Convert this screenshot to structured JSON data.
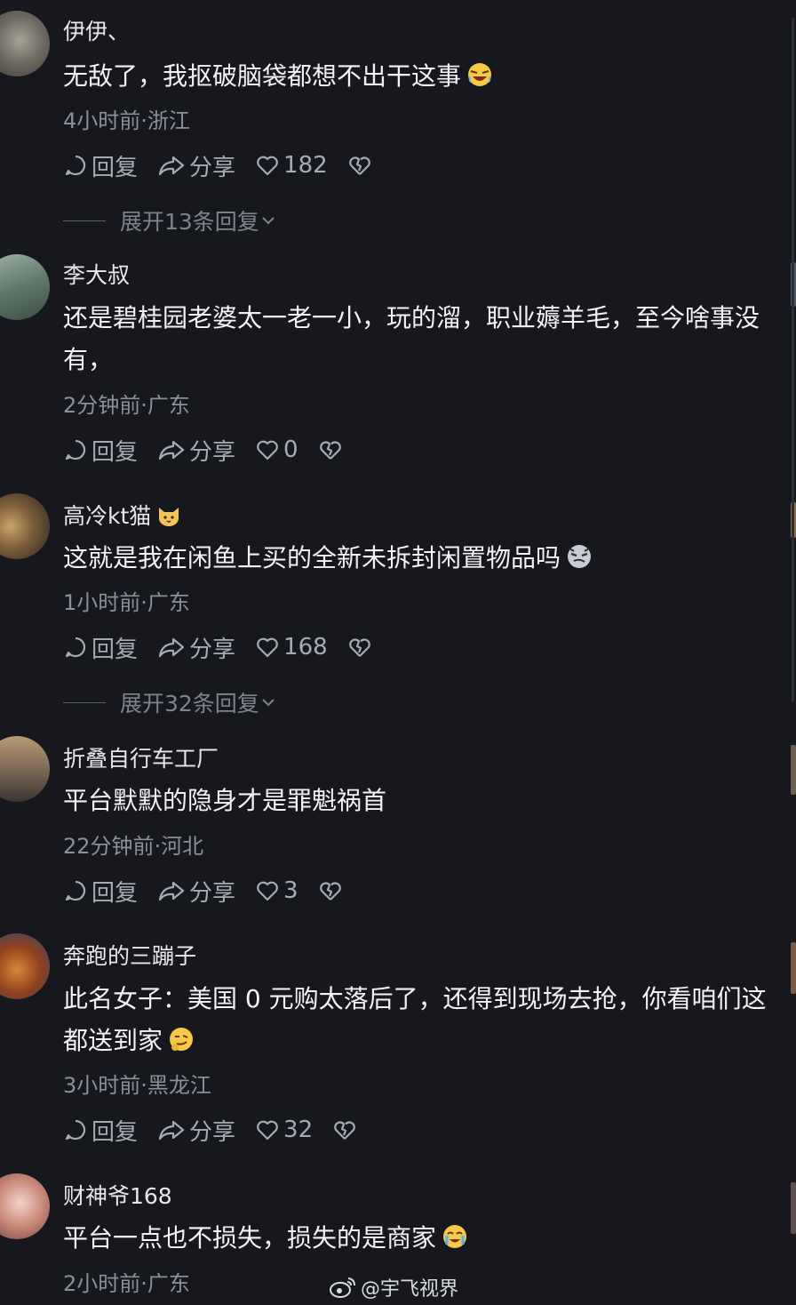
{
  "comments": [
    {
      "username": "伊伊、",
      "text": "无敌了，我抠破脑袋都想不出干这事",
      "emoji": "laughing-crying-emoji",
      "meta": "4小时前·浙江",
      "reply_label": "回复",
      "share_label": "分享",
      "likes": "182",
      "expand_label": "展开13条回复"
    },
    {
      "username": "李大叔",
      "text": "还是碧桂园老婆太一老一小，玩的溜，职业薅羊毛，至今啥事没有，",
      "meta": "2分钟前·广东",
      "reply_label": "回复",
      "share_label": "分享",
      "likes": "0"
    },
    {
      "username": "高冷kt猫",
      "username_badge": "cat-face-emoji",
      "text": "这就是我在闲鱼上买的全新未拆封闲置物品吗",
      "emoji": "sly-face-emoji",
      "meta": "1小时前·广东",
      "reply_label": "回复",
      "share_label": "分享",
      "likes": "168",
      "expand_label": "展开32条回复"
    },
    {
      "username": "折叠自行车工厂",
      "text": "平台默默的隐身才是罪魁祸首",
      "meta": "22分钟前·河北",
      "reply_label": "回复",
      "share_label": "分享",
      "likes": "3"
    },
    {
      "username": "奔跑的三蹦子",
      "text": "此名女子：美国 0 元购太落后了，还得到现场去抢，你看咱们这都送到家",
      "emoji": "thinking-smirk-emoji",
      "meta": "3小时前·黑龙江",
      "reply_label": "回复",
      "share_label": "分享",
      "likes": "32"
    },
    {
      "username": "财神爷168",
      "text": "平台一点也不损失，损失的是商家",
      "emoji": "crying-laughing-emoji",
      "meta": "2小时前·广东"
    }
  ],
  "watermark": "@宇飞视界",
  "colors": {
    "background": "#16181d",
    "meta": "#8b8f99",
    "action": "#a6aab3"
  }
}
